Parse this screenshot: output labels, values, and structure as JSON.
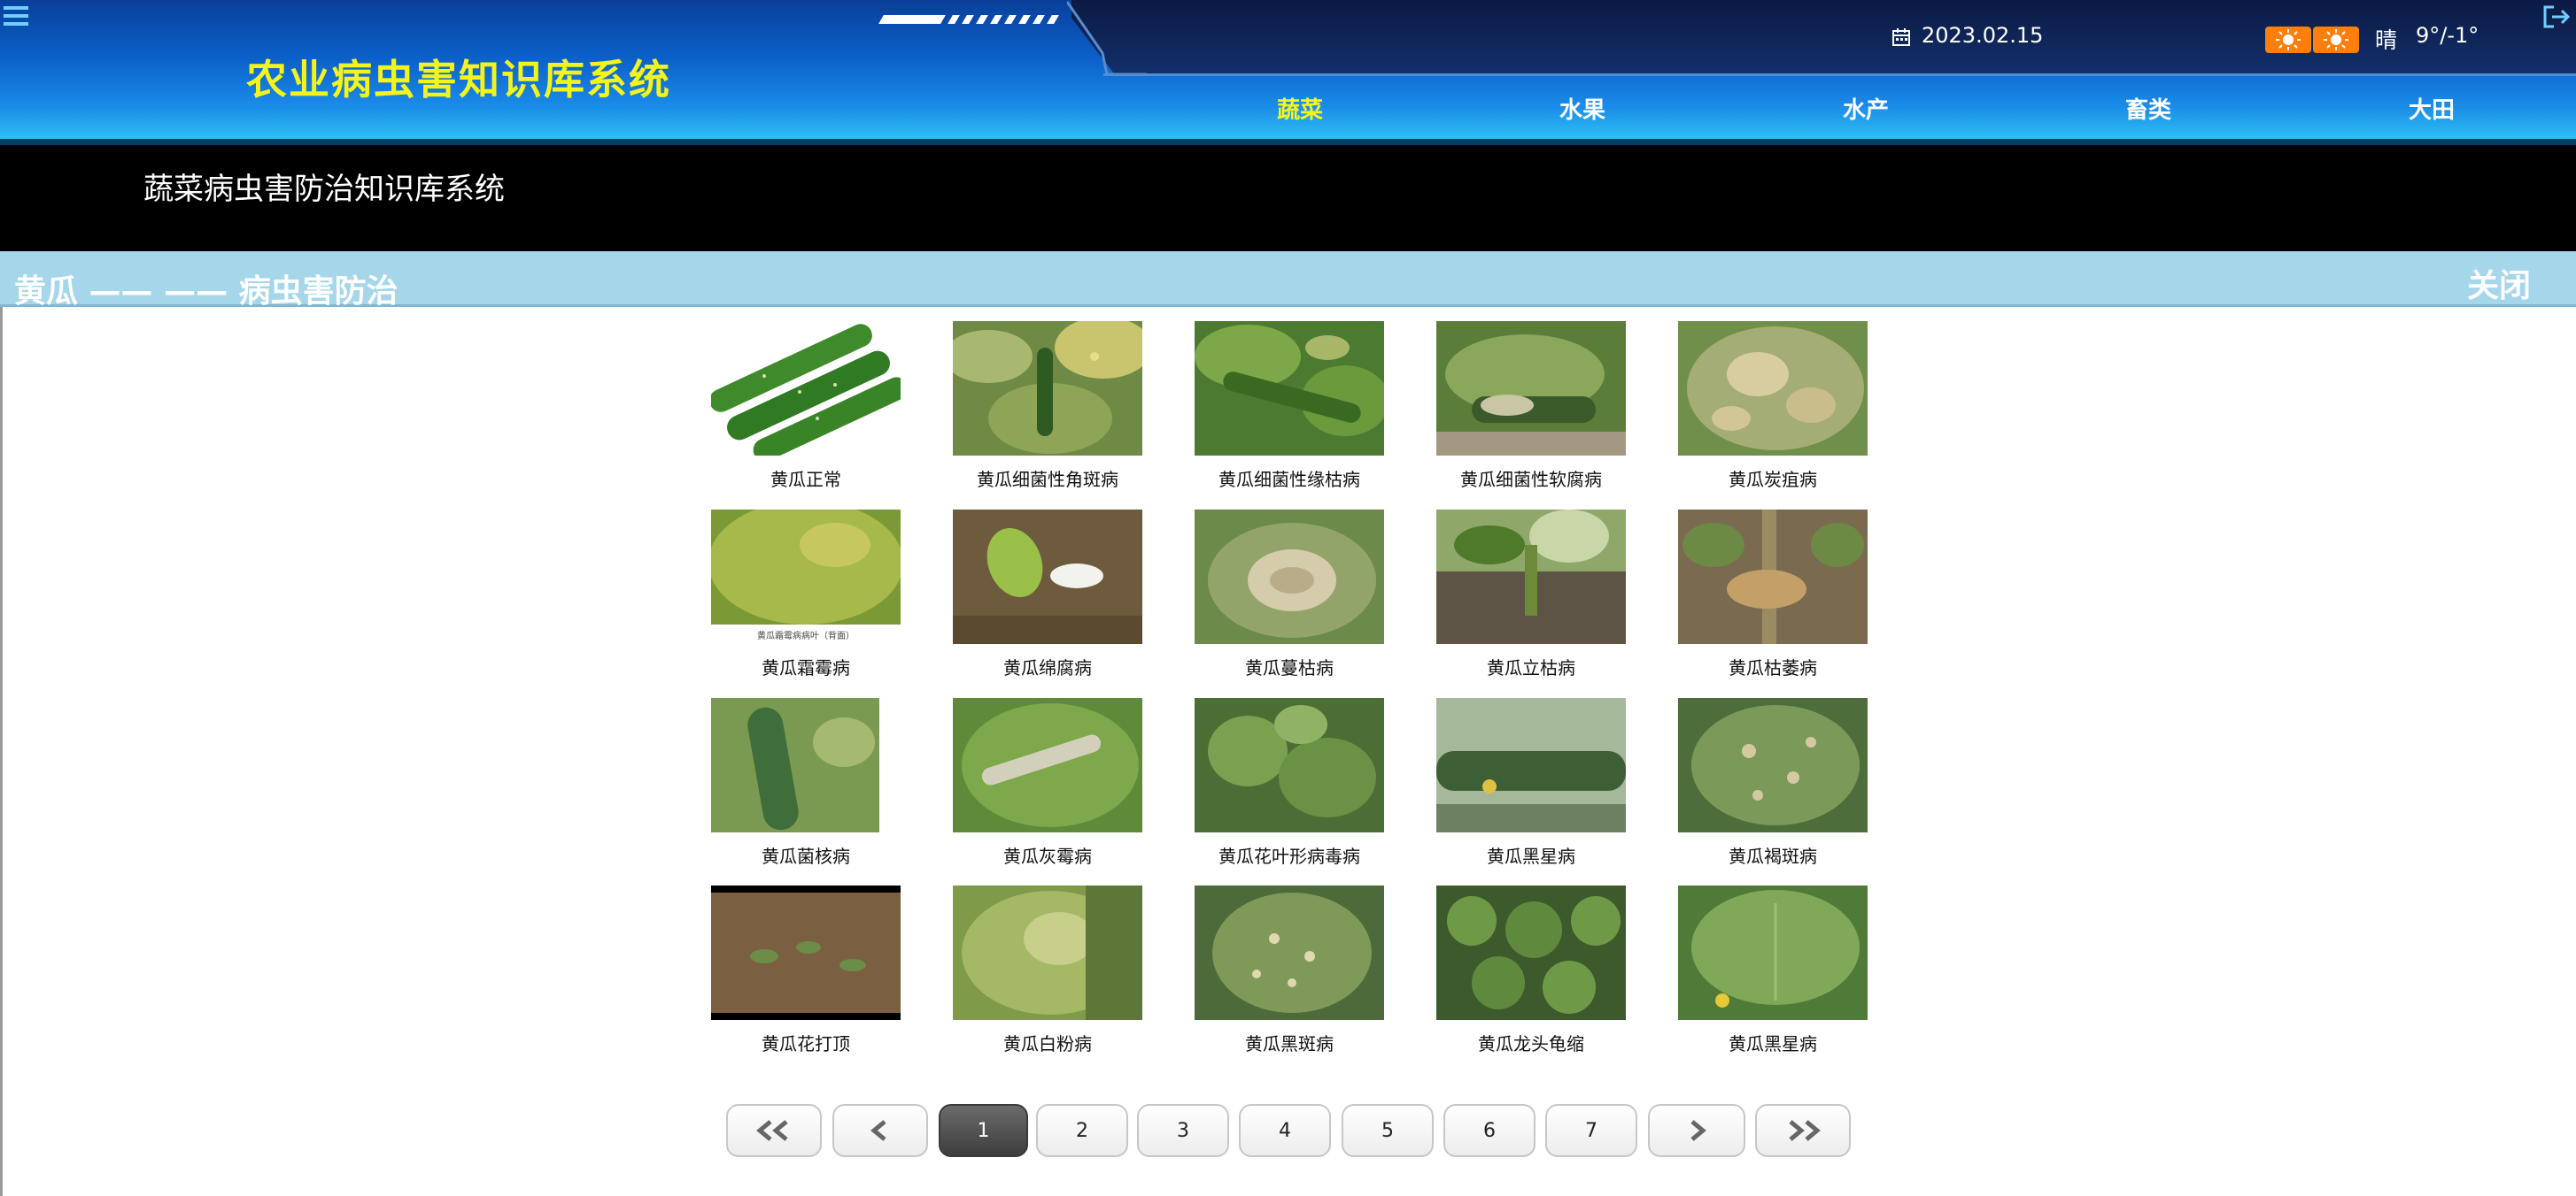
{
  "header": {
    "app_title": "农业病虫害知识库系统",
    "date": "2023.02.15",
    "weather": "晴",
    "temperature": "9°/-1°",
    "weather_icons": [
      "sun-icon",
      "sun-icon"
    ],
    "nav": [
      {
        "label": "蔬菜",
        "active": true
      },
      {
        "label": "水果",
        "active": false
      },
      {
        "label": "水产",
        "active": false
      },
      {
        "label": "畜类",
        "active": false
      },
      {
        "label": "大田",
        "active": false
      }
    ]
  },
  "subtitle": "蔬菜病虫害防治知识库系统",
  "section": {
    "title": "黄瓜 —— —— 病虫害防治",
    "close_label": "关闭"
  },
  "items": [
    {
      "label": "黄瓜正常"
    },
    {
      "label": "黄瓜细菌性角斑病"
    },
    {
      "label": "黄瓜细菌性缘枯病"
    },
    {
      "label": "黄瓜细菌性软腐病"
    },
    {
      "label": "黄瓜炭疽病"
    },
    {
      "label": "黄瓜霜霉病",
      "caption": "黄瓜霜霉病病叶（背面）"
    },
    {
      "label": "黄瓜绵腐病"
    },
    {
      "label": "黄瓜蔓枯病"
    },
    {
      "label": "黄瓜立枯病"
    },
    {
      "label": "黄瓜枯萎病"
    },
    {
      "label": "黄瓜菌核病"
    },
    {
      "label": "黄瓜灰霉病"
    },
    {
      "label": "黄瓜花叶形病毒病"
    },
    {
      "label": "黄瓜黑星病"
    },
    {
      "label": "黄瓜褐斑病"
    },
    {
      "label": "黄瓜花打顶"
    },
    {
      "label": "黄瓜白粉病"
    },
    {
      "label": "黄瓜黑斑病"
    },
    {
      "label": "黄瓜龙头龟缩"
    },
    {
      "label": "黄瓜黑星病"
    }
  ],
  "pagination": {
    "first_icon": "double-chevron-left-icon",
    "prev_icon": "chevron-left-icon",
    "next_icon": "chevron-right-icon",
    "last_icon": "double-chevron-right-icon",
    "pages": [
      "1",
      "2",
      "3",
      "4",
      "5",
      "6",
      "7"
    ],
    "current": "1"
  },
  "colors": {
    "title_yellow": "#f4f41c",
    "active_nav": "#f6f61a",
    "section_bar": "#a5d6ea",
    "weather_badge": "#ff7f0a"
  }
}
